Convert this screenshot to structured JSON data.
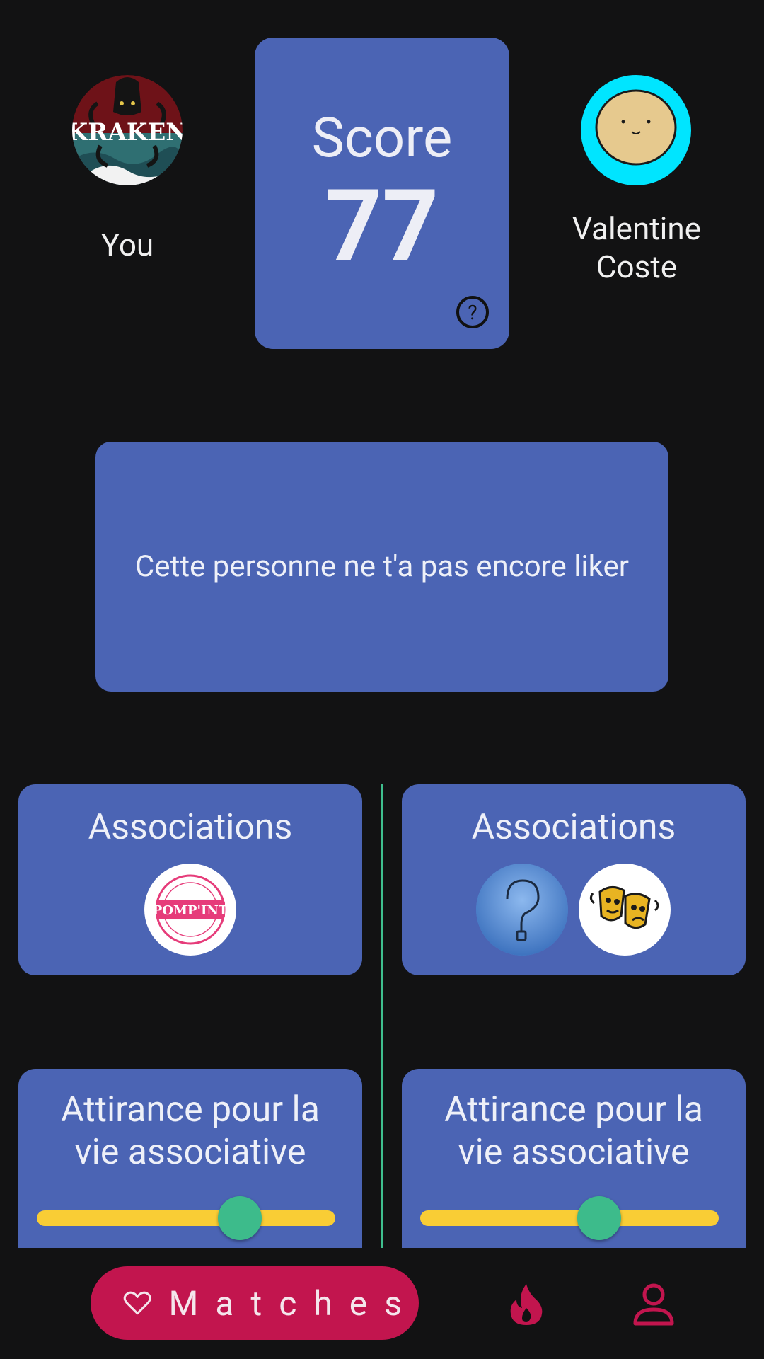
{
  "header": {
    "left_user": {
      "label": "You",
      "avatar_icon": "kraken-logo-avatar",
      "avatar_text": "KRAKEN"
    },
    "score": {
      "title": "Score",
      "value": "77",
      "help_icon": "question-circle-icon",
      "help_glyph": "?"
    },
    "right_user": {
      "name_line1": "Valentine",
      "name_line2": "Coste",
      "avatar_icon": "smiley-face-avatar"
    }
  },
  "like_status": {
    "text": "Cette personne ne t'a pas encore liker"
  },
  "comparison": {
    "left": {
      "associations": {
        "title": "Associations",
        "logos": [
          {
            "icon": "pompint-logo",
            "text": "POMP'INT"
          }
        ]
      },
      "attraction": {
        "title_line1": "Attirance pour la",
        "title_line2": "vie associative",
        "value_fraction": 0.68
      }
    },
    "right": {
      "associations": {
        "title": "Associations",
        "logos": [
          {
            "icon": "question-mark-logo"
          },
          {
            "icon": "theatre-masks-logo"
          }
        ]
      },
      "attraction": {
        "title_line1": "Attirance pour la",
        "title_line2": "vie associative",
        "value_fraction": 0.6
      }
    }
  },
  "bottom_nav": {
    "matches_label": "Matches",
    "matches_icon": "heart-icon",
    "flame_icon": "flame-icon",
    "profile_icon": "person-icon",
    "accent_color": "#C2154E"
  },
  "colors": {
    "card": "#4B64B4",
    "background": "#121213",
    "slider_track": "#F9CD35",
    "slider_thumb": "#3DBB8B",
    "divider": "#3FBF8E"
  }
}
